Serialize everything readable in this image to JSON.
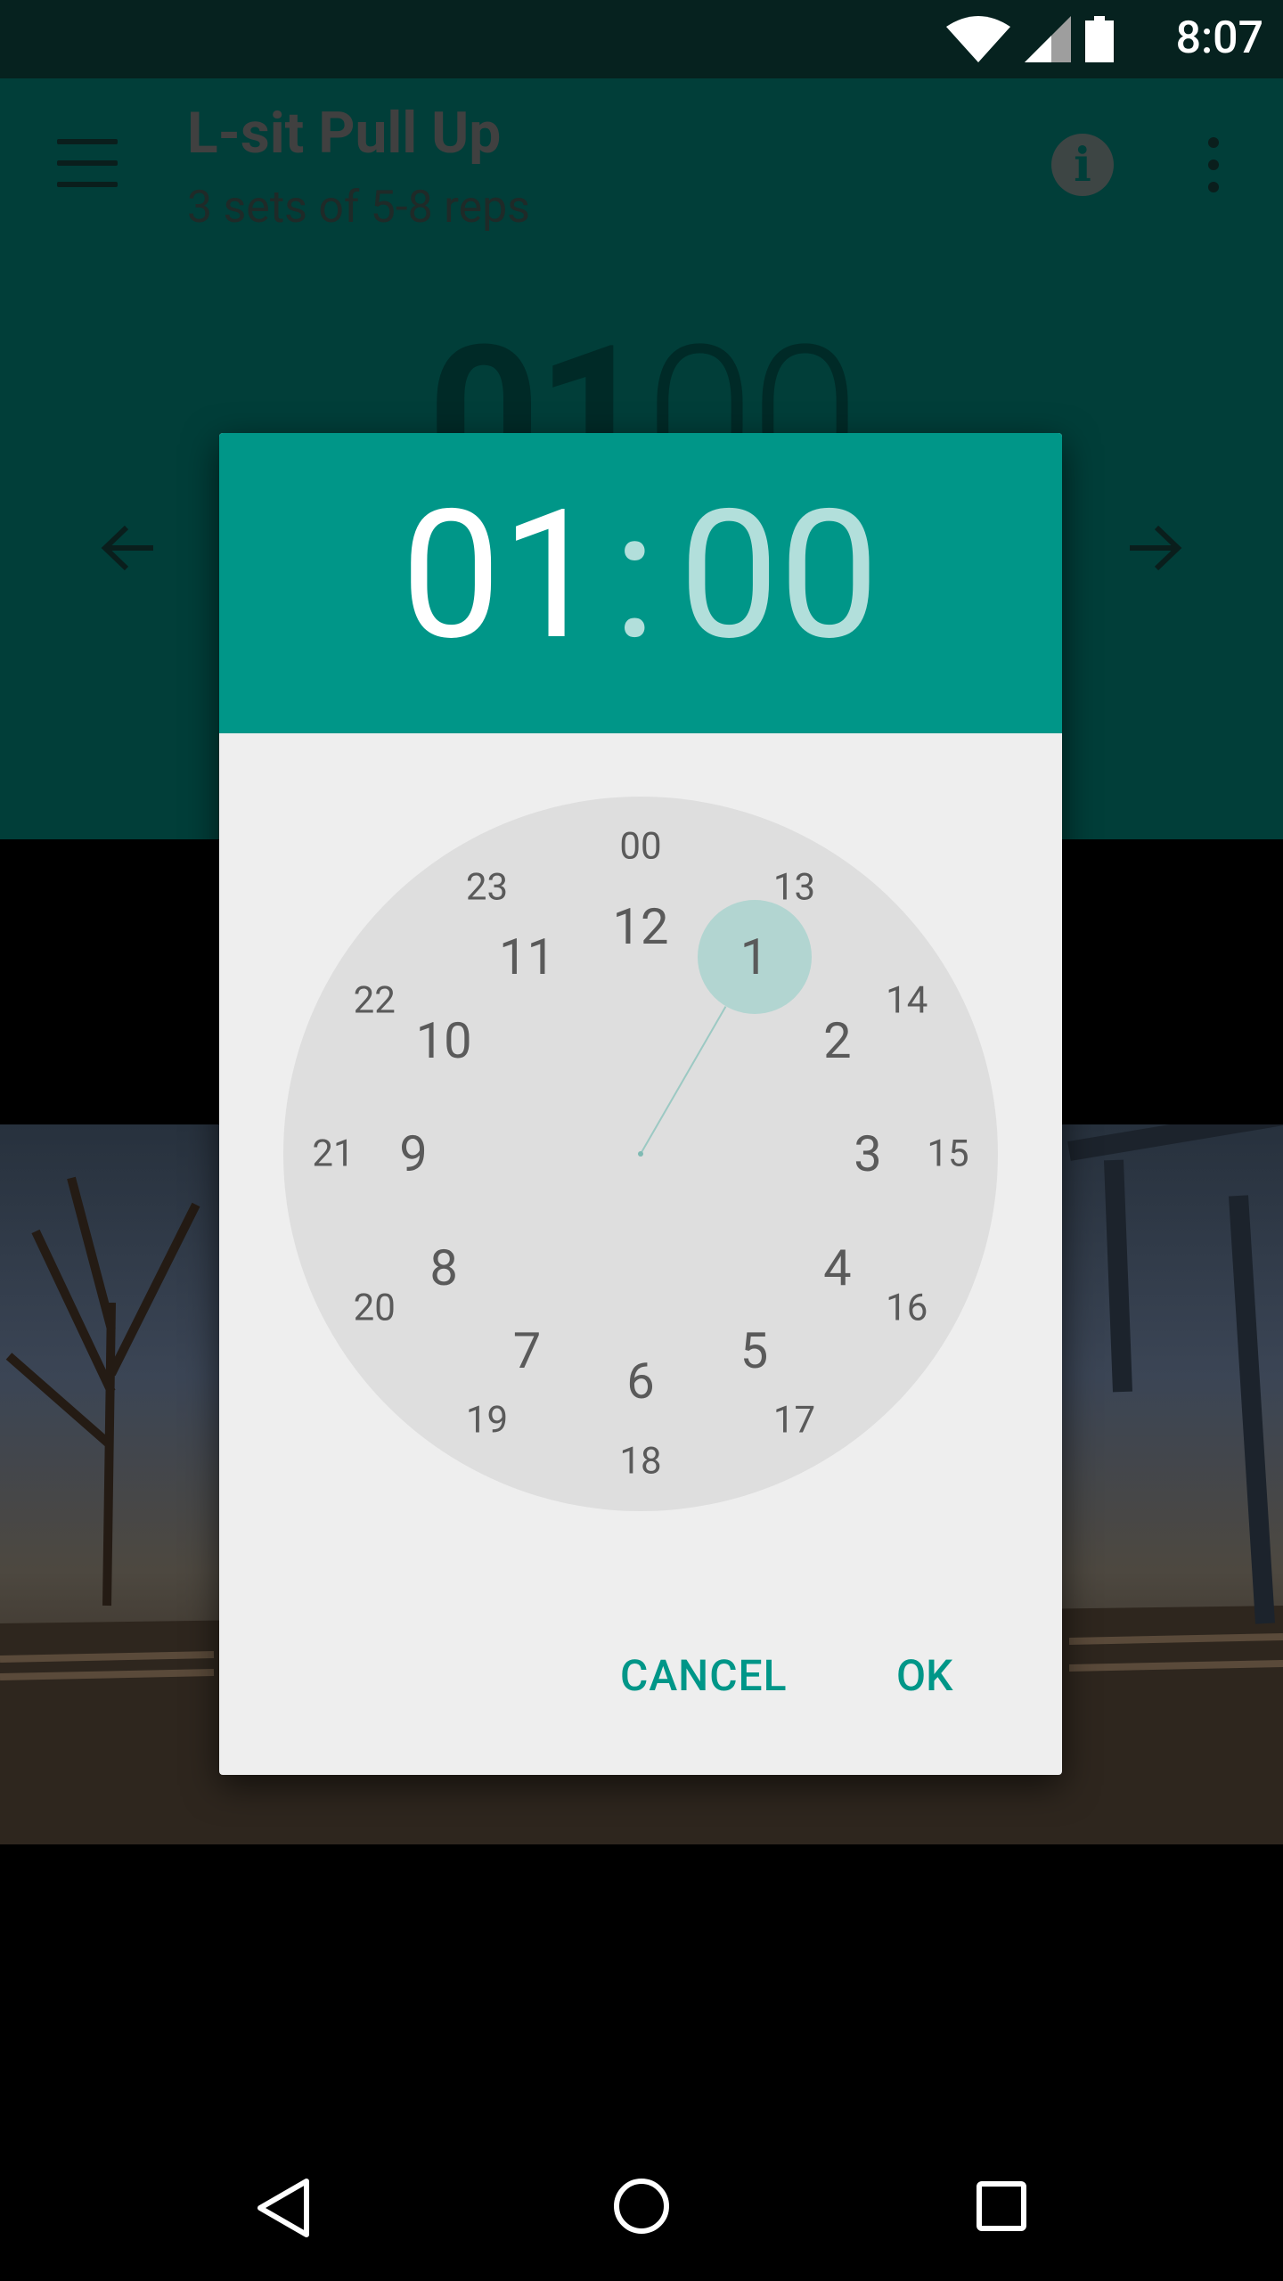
{
  "status_bar": {
    "time": "8:07"
  },
  "app_bar": {
    "title": "L-sit Pull Up",
    "subtitle": "3 sets of 5-8 reps",
    "timer_minutes": "01",
    "timer_seconds": "00"
  },
  "dialog": {
    "hour": "01",
    "separator": ":",
    "minute": "00",
    "selected_hour": 1,
    "outer_ring": [
      "12",
      "1",
      "2",
      "3",
      "4",
      "5",
      "6",
      "7",
      "8",
      "9",
      "10",
      "11"
    ],
    "inner_ring": [
      "00",
      "13",
      "14",
      "15",
      "16",
      "17",
      "18",
      "19",
      "20",
      "21",
      "22",
      "23"
    ],
    "cancel_label": "CANCEL",
    "ok_label": "OK"
  },
  "colors": {
    "accent": "#009688",
    "accent_light": "#b2dfdb",
    "dialog_bg": "#eeeeee",
    "clock_face": "#dedede",
    "selector": "#b2d5d1",
    "scrim_app_bar": "#013e39"
  },
  "icons": {
    "status": [
      "wifi-icon",
      "signal-icon",
      "battery-icon"
    ],
    "app_bar": [
      "menu-icon",
      "info-icon",
      "overflow-icon"
    ],
    "nav": [
      "prev-arrow-icon",
      "next-arrow-icon"
    ],
    "system_nav": [
      "back-icon",
      "home-icon",
      "recents-icon"
    ]
  }
}
